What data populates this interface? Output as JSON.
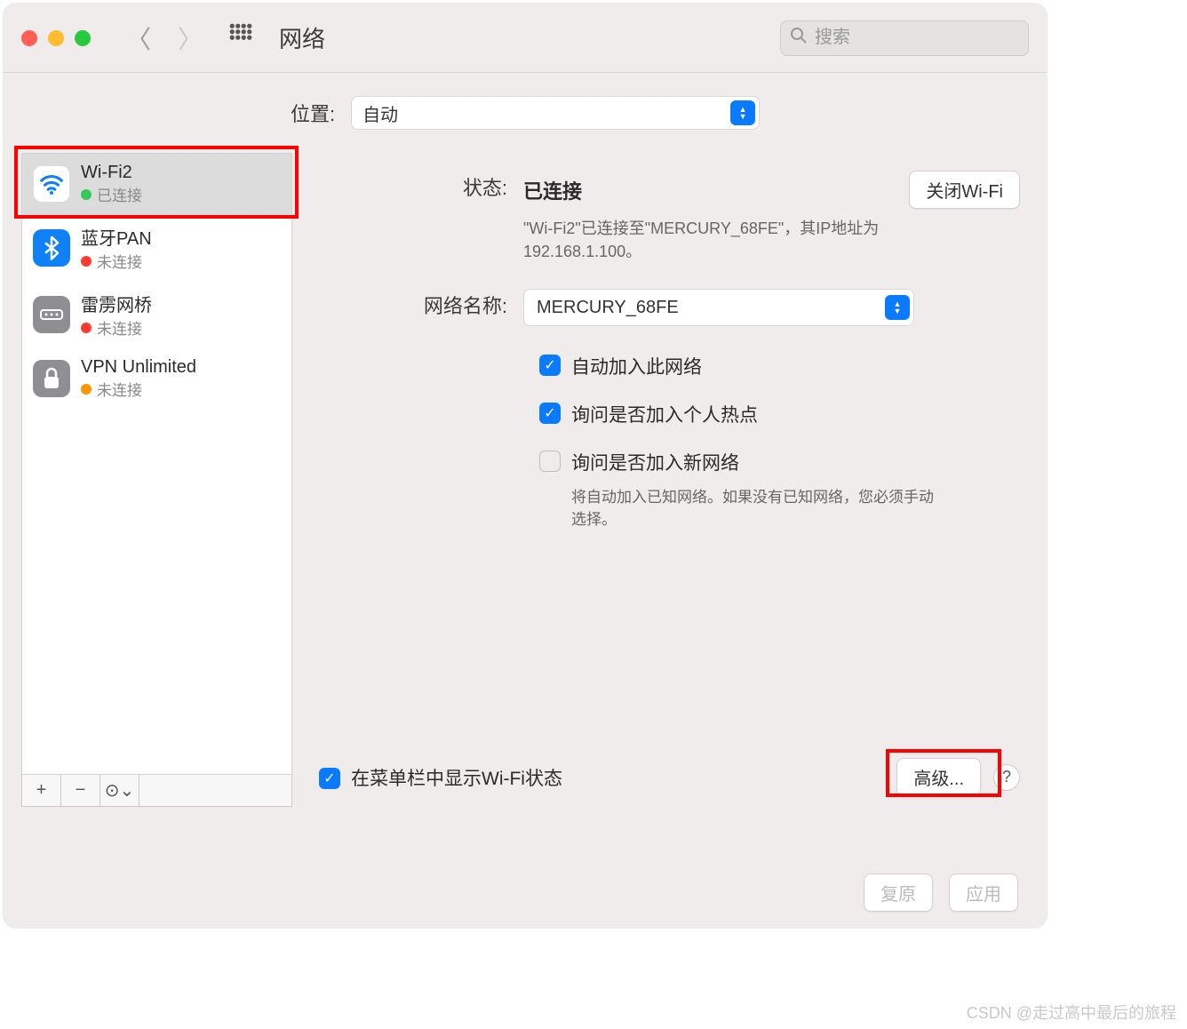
{
  "window": {
    "title": "网络",
    "search_placeholder": "搜索"
  },
  "location": {
    "label": "位置:",
    "value": "自动"
  },
  "sidebar": {
    "items": [
      {
        "name": "Wi-Fi2",
        "status_text": "已连接",
        "status_color": "green",
        "icon": "wifi",
        "selected": true
      },
      {
        "name": "蓝牙PAN",
        "status_text": "未连接",
        "status_color": "red",
        "icon": "bluetooth",
        "selected": false
      },
      {
        "name": "雷雳网桥",
        "status_text": "未连接",
        "status_color": "red",
        "icon": "thunderbolt",
        "selected": false
      },
      {
        "name": "VPN Unlimited",
        "status_text": "未连接",
        "status_color": "orange",
        "icon": "vpn",
        "selected": false
      }
    ]
  },
  "detail": {
    "status_label": "状态:",
    "status_value": "已连接",
    "wifi_toggle_label": "关闭Wi-Fi",
    "status_desc": "\"Wi-Fi2\"已连接至\"MERCURY_68FE\"，其IP地址为 192.168.1.100。",
    "network_name_label": "网络名称:",
    "network_name_value": "MERCURY_68FE",
    "checkboxes": [
      {
        "label": "自动加入此网络",
        "checked": true,
        "desc": ""
      },
      {
        "label": "询问是否加入个人热点",
        "checked": true,
        "desc": ""
      },
      {
        "label": "询问是否加入新网络",
        "checked": false,
        "desc": "将自动加入已知网络。如果没有已知网络，您必须手动选择。"
      }
    ],
    "menubar_checkbox": {
      "label": "在菜单栏中显示Wi-Fi状态",
      "checked": true
    },
    "advanced_button": "高级...",
    "help_label": "?"
  },
  "footer": {
    "revert": "复原",
    "apply": "应用"
  },
  "watermark": "CSDN @走过高中最后的旅程"
}
